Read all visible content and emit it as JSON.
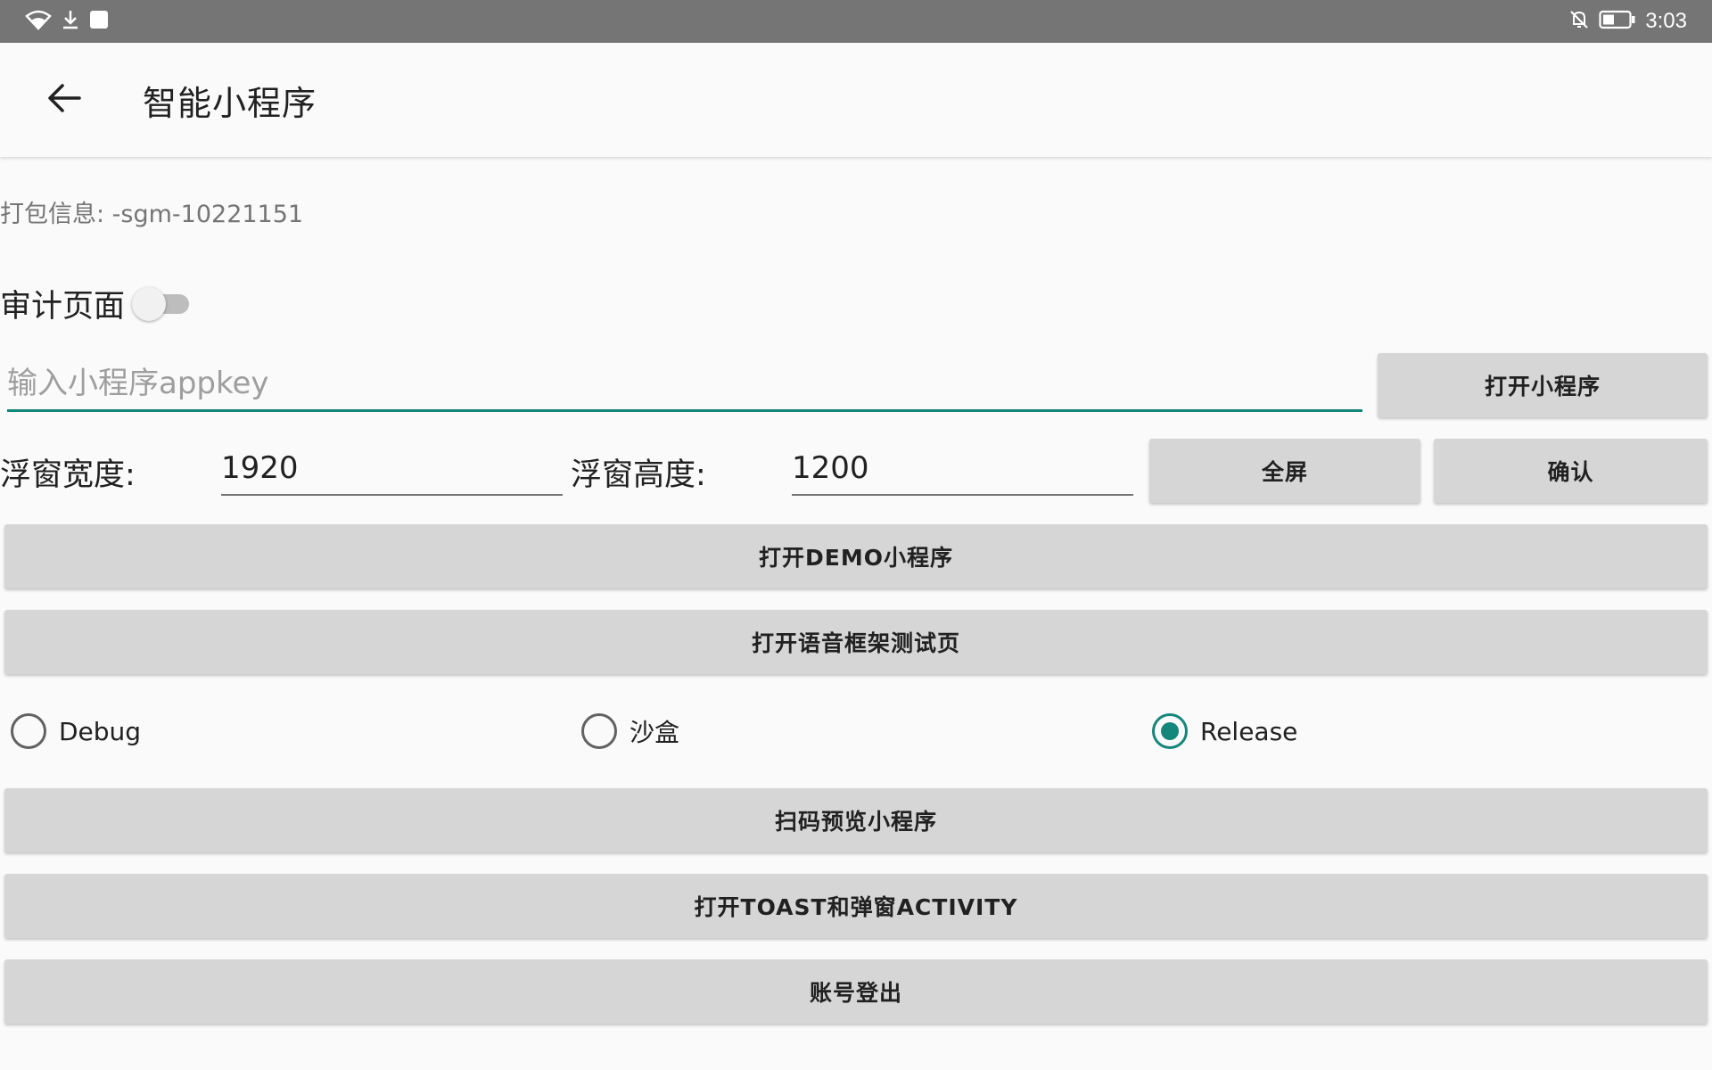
{
  "status_bar": {
    "time": "3:03",
    "icons": [
      "wifi-icon",
      "download-icon",
      "notification-icon",
      "mute-icon",
      "battery-icon"
    ]
  },
  "toolbar": {
    "title": "智能小程序",
    "back_icon": "arrow-left-icon"
  },
  "build_info": "打包信息: -sgm-10221151",
  "audit": {
    "label": "审计页面",
    "enabled": false
  },
  "appkey": {
    "placeholder": "输入小程序appkey",
    "value": ""
  },
  "buttons": {
    "open_mini_program": "打开小程序",
    "fullscreen": "全屏",
    "confirm": "确认",
    "open_demo": "打开DEMO小程序",
    "open_voice_test": "打开语音框架测试页",
    "scan_preview": "扫码预览小程序",
    "open_toast_activity": "打开TOAST和弹窗ACTIVITY",
    "logout": "账号登出"
  },
  "float_window": {
    "width_label": "浮窗宽度:",
    "width_value": "1920",
    "height_label": "浮窗高度:",
    "height_value": "1200"
  },
  "environment": {
    "options": [
      "Debug",
      "沙盒",
      "Release"
    ],
    "selected": "Release"
  },
  "colors": {
    "accent": "#14877a",
    "status_bar": "#757575",
    "button": "#d6d6d6"
  }
}
